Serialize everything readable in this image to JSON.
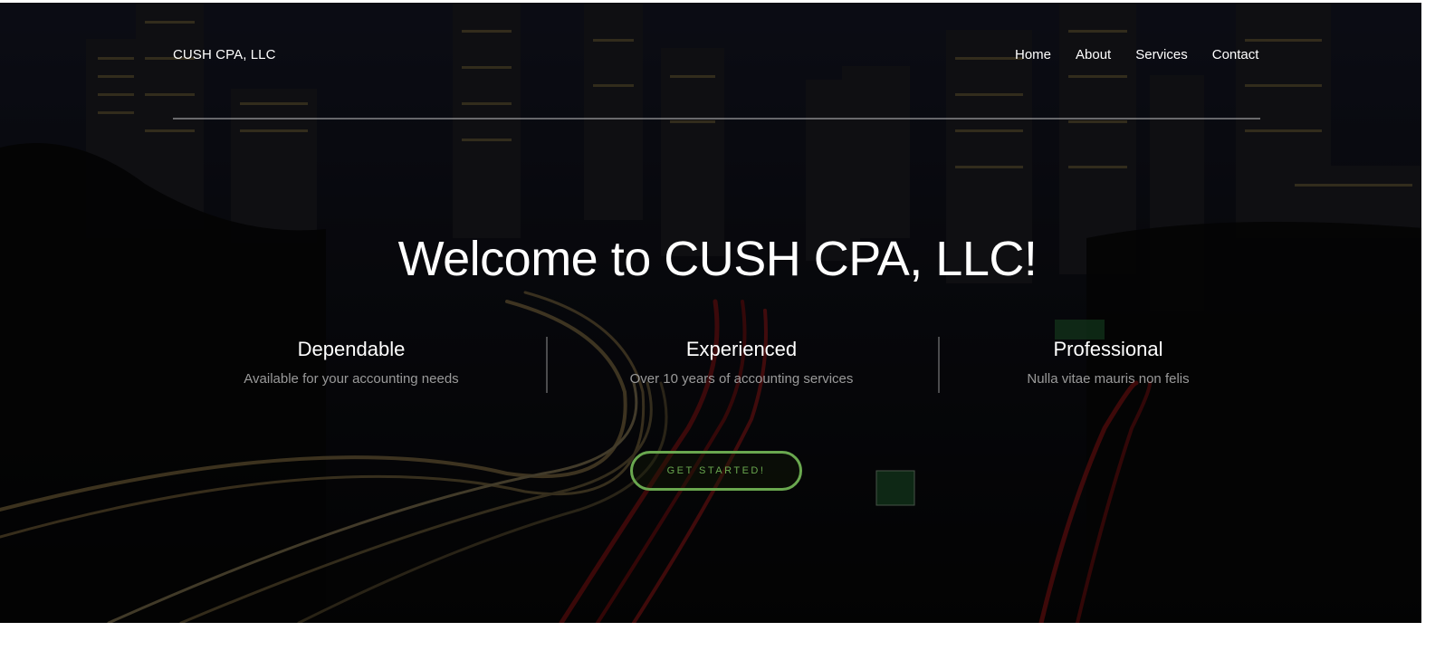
{
  "brand": "CUSH CPA, LLC",
  "nav": [
    "Home",
    "About",
    "Services",
    "Contact"
  ],
  "headline": "Welcome to CUSH CPA, LLC!",
  "features": [
    {
      "title": "Dependable",
      "description": "Available for your accounting needs"
    },
    {
      "title": "Experienced",
      "description": "Over 10 years of accounting services"
    },
    {
      "title": "Professional",
      "description": "Nulla vitae mauris non felis"
    }
  ],
  "cta_label": "GET STARTED!",
  "colors": {
    "accent": "#6aa84f",
    "overlay": "#000000",
    "text": "#ffffff",
    "muted": "#9a9a9a"
  },
  "background_image": "night city skyline with highway light trails"
}
